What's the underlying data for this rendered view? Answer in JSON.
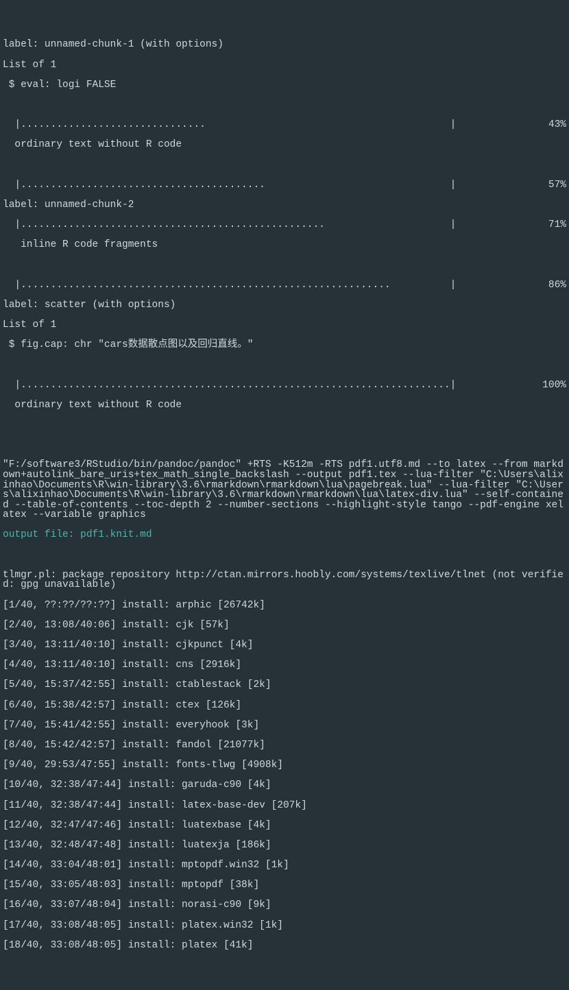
{
  "header": {
    "line0": "label: unnamed-chunk-1 (with options)",
    "line1": "List of 1",
    "line2": " $ eval: logi FALSE"
  },
  "progress": [
    {
      "dots": "  |...............................                                         |",
      "pct": "  43%"
    },
    {
      "text": "  ordinary text without R code"
    },
    {
      "dots": "  |.........................................                               |",
      "pct": "  57%"
    },
    {
      "text": "label: unnamed-chunk-2"
    },
    {
      "dots2": "  |...................................................                     |",
      "pct": "  71%"
    },
    {
      "text": "   inline R code fragments"
    },
    {
      "dots": "  |..............................................................          |",
      "pct": "  86%"
    },
    {
      "text": "label: scatter (with options)"
    },
    {
      "text": "List of 1"
    },
    {
      "text": " $ fig.cap: chr \"cars数据散点图以及回归直线。\""
    },
    {
      "dots": "  |........................................................................|",
      "pct": " 100%"
    },
    {
      "text": "  ordinary text without R code"
    }
  ],
  "pandoc": "\"F:/software3/RStudio/bin/pandoc/pandoc\" +RTS -K512m -RTS pdf1.utf8.md --to latex --from markdown+autolink_bare_uris+tex_math_single_backslash --output pdf1.tex --lua-filter \"C:\\Users\\alixinhao\\Documents\\R\\win-library\\3.6\\rmarkdown\\rmarkdown\\lua\\pagebreak.lua\" --lua-filter \"C:\\Users\\alixinhao\\Documents\\R\\win-library\\3.6\\rmarkdown\\rmarkdown\\lua\\latex-div.lua\" --self-contained --table-of-contents --toc-depth 2 --number-sections --highlight-style tango --pdf-engine xelatex --variable graphics",
  "output_file": "output file: pdf1.knit.md",
  "tlmgr": "tlmgr.pl: package repository http://ctan.mirrors.hoobly.com/systems/texlive/tlnet (not verified: gpg unavailable)",
  "installs": [
    "[1/40, ??:??/??:??] install: arphic [26742k]",
    "[2/40, 13:08/40:06] install: cjk [57k]",
    "[3/40, 13:11/40:10] install: cjkpunct [4k]",
    "[4/40, 13:11/40:10] install: cns [2916k]",
    "[5/40, 15:37/42:55] install: ctablestack [2k]",
    "[6/40, 15:38/42:57] install: ctex [126k]",
    "[7/40, 15:41/42:55] install: everyhook [3k]",
    "[8/40, 15:42/42:57] install: fandol [21077k]",
    "[9/40, 29:53/47:55] install: fonts-tlwg [4908k]",
    "[10/40, 32:38/47:44] install: garuda-c90 [4k]",
    "[11/40, 32:38/47:44] install: latex-base-dev [207k]",
    "[12/40, 32:47/47:46] install: luatexbase [4k]",
    "[13/40, 32:48/47:48] install: luatexja [186k]",
    "[14/40, 33:04/48:01] install: mptopdf.win32 [1k]",
    "[15/40, 33:05/48:03] install: mptopdf [38k]",
    "[16/40, 33:07/48:04] install: norasi-c90 [9k]",
    "[17/40, 33:08/48:05] install: platex.win32 [1k]",
    "[18/40, 33:08/48:05] install: platex [41k]"
  ]
}
